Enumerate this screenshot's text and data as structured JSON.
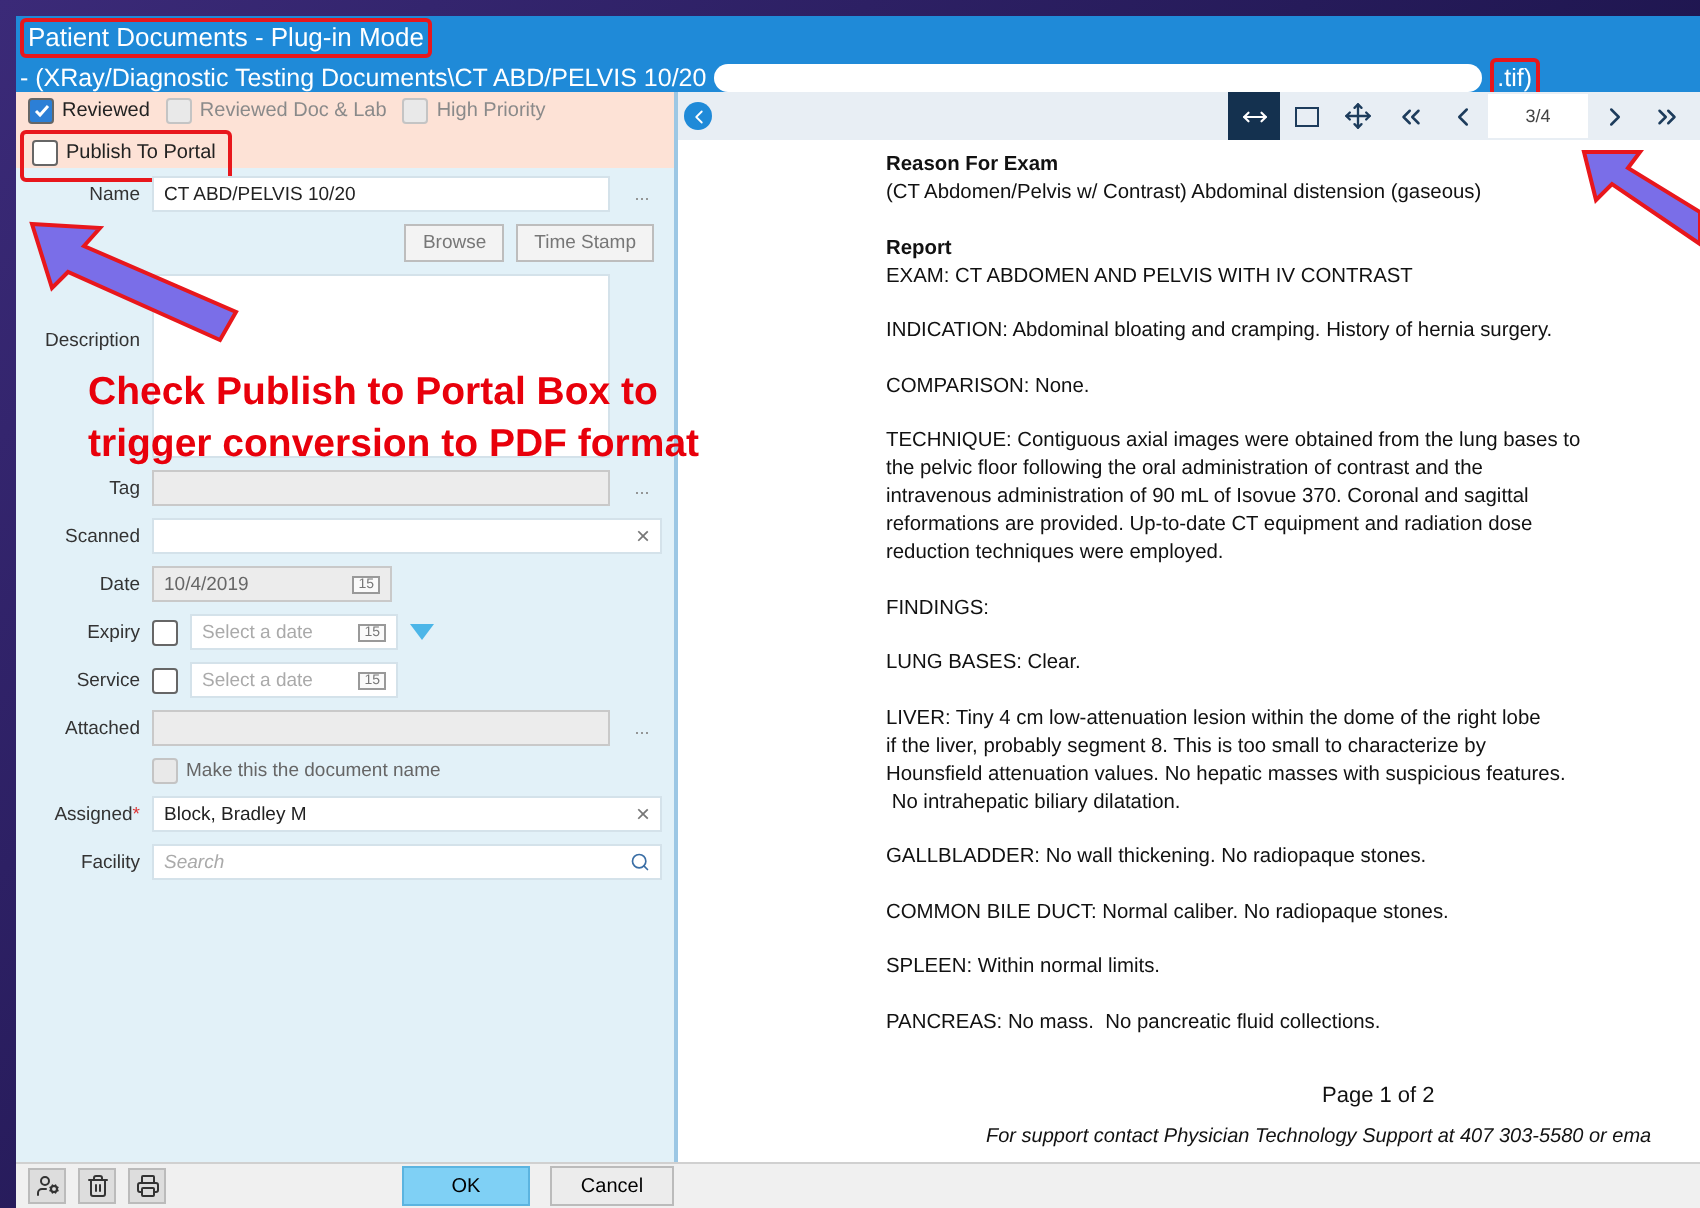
{
  "window": {
    "title": "Patient Documents - Plug-in Mode",
    "subtitle_start": "- (XRay/Diagnostic Testing Documents\\CT ABD/PELVIS 10/20",
    "subtitle_end": ".tif)"
  },
  "flags": [
    {
      "label": "Reviewed",
      "checked": true,
      "disabled": false
    },
    {
      "label": "Reviewed Doc & Lab",
      "checked": false,
      "disabled": true
    },
    {
      "label": "High Priority",
      "checked": false,
      "disabled": true
    },
    {
      "label": "Publish To Portal",
      "checked": false,
      "disabled": false
    }
  ],
  "form": {
    "name": {
      "label": "Name",
      "value": "CT ABD/PELVIS 10/20",
      "more": "..."
    },
    "buttons": [
      "Browse",
      "Time Stamp"
    ],
    "description": {
      "label": "Description"
    },
    "tag": {
      "label": "Tag",
      "more": "..."
    },
    "scanned": {
      "label": "Scanned",
      "clear": "×"
    },
    "date": {
      "label": "Date",
      "value": "10/4/2019",
      "calendar": "15"
    },
    "expiry": {
      "label": "Expiry",
      "checked": false,
      "placeholder": "Select a date",
      "calendar": "15"
    },
    "service": {
      "label": "Service",
      "checked": false,
      "placeholder": "Select a date",
      "calendar": "15"
    },
    "attached": {
      "label": "Attached",
      "more": "...",
      "option": "Make this the document name",
      "option_checked": false
    },
    "assigned": {
      "label": "Assigned",
      "required": "*",
      "value": "Block, Bradley M",
      "clear": "×"
    },
    "facility": {
      "label": "Facility",
      "placeholder": "Search"
    }
  },
  "footer": {
    "buttons": [
      "OK",
      "Cancel"
    ]
  },
  "viewer": {
    "page_field": "3/4"
  },
  "document": {
    "paragraphs": [
      {
        "heading": "Reason For Exam",
        "lines": [
          "(CT Abdomen/Pelvis w/ Contrast) Abdominal distension (gaseous)"
        ]
      },
      {
        "heading": "Report",
        "lines": [
          "EXAM: CT ABDOMEN AND PELVIS WITH IV CONTRAST"
        ]
      },
      {
        "lines": [
          "INDICATION: Abdominal bloating and cramping. History of hernia surgery."
        ]
      },
      {
        "lines": [
          "COMPARISON: None."
        ]
      },
      {
        "lines": [
          "TECHNIQUE: Contiguous axial images were obtained from the lung bases to",
          "the pelvic floor following the oral administration of contrast and the",
          "intravenous administration of 90 mL of Isovue 370. Coronal and sagittal",
          "reformations are provided. Up-to-date CT equipment and radiation dose",
          "reduction techniques were employed."
        ]
      },
      {
        "lines": [
          "FINDINGS:"
        ]
      },
      {
        "lines": [
          "LUNG BASES: Clear."
        ]
      },
      {
        "lines": [
          "LIVER: Tiny 4 cm low-attenuation lesion within the dome of the right lobe",
          "if the liver, probably segment 8. This is too small to characterize by",
          "Hounsfield attenuation values. No hepatic masses with suspicious features.",
          " No intrahepatic biliary dilatation."
        ]
      },
      {
        "lines": [
          "GALLBLADDER: No wall thickening. No radiopaque stones."
        ]
      },
      {
        "lines": [
          "COMMON BILE DUCT: Normal caliber. No radiopaque stones."
        ]
      },
      {
        "lines": [
          "SPLEEN: Within normal limits."
        ]
      },
      {
        "lines": [
          "PANCREAS: No mass.  No pancreatic fluid collections."
        ]
      }
    ],
    "page_label": "Page 1 of 2",
    "footer": "For support contact Physician Technology Support at 407 303-5580 or ema"
  },
  "annotation": {
    "lines": [
      "Check Publish to Portal Box to",
      "trigger conversion to PDF format"
    ]
  }
}
